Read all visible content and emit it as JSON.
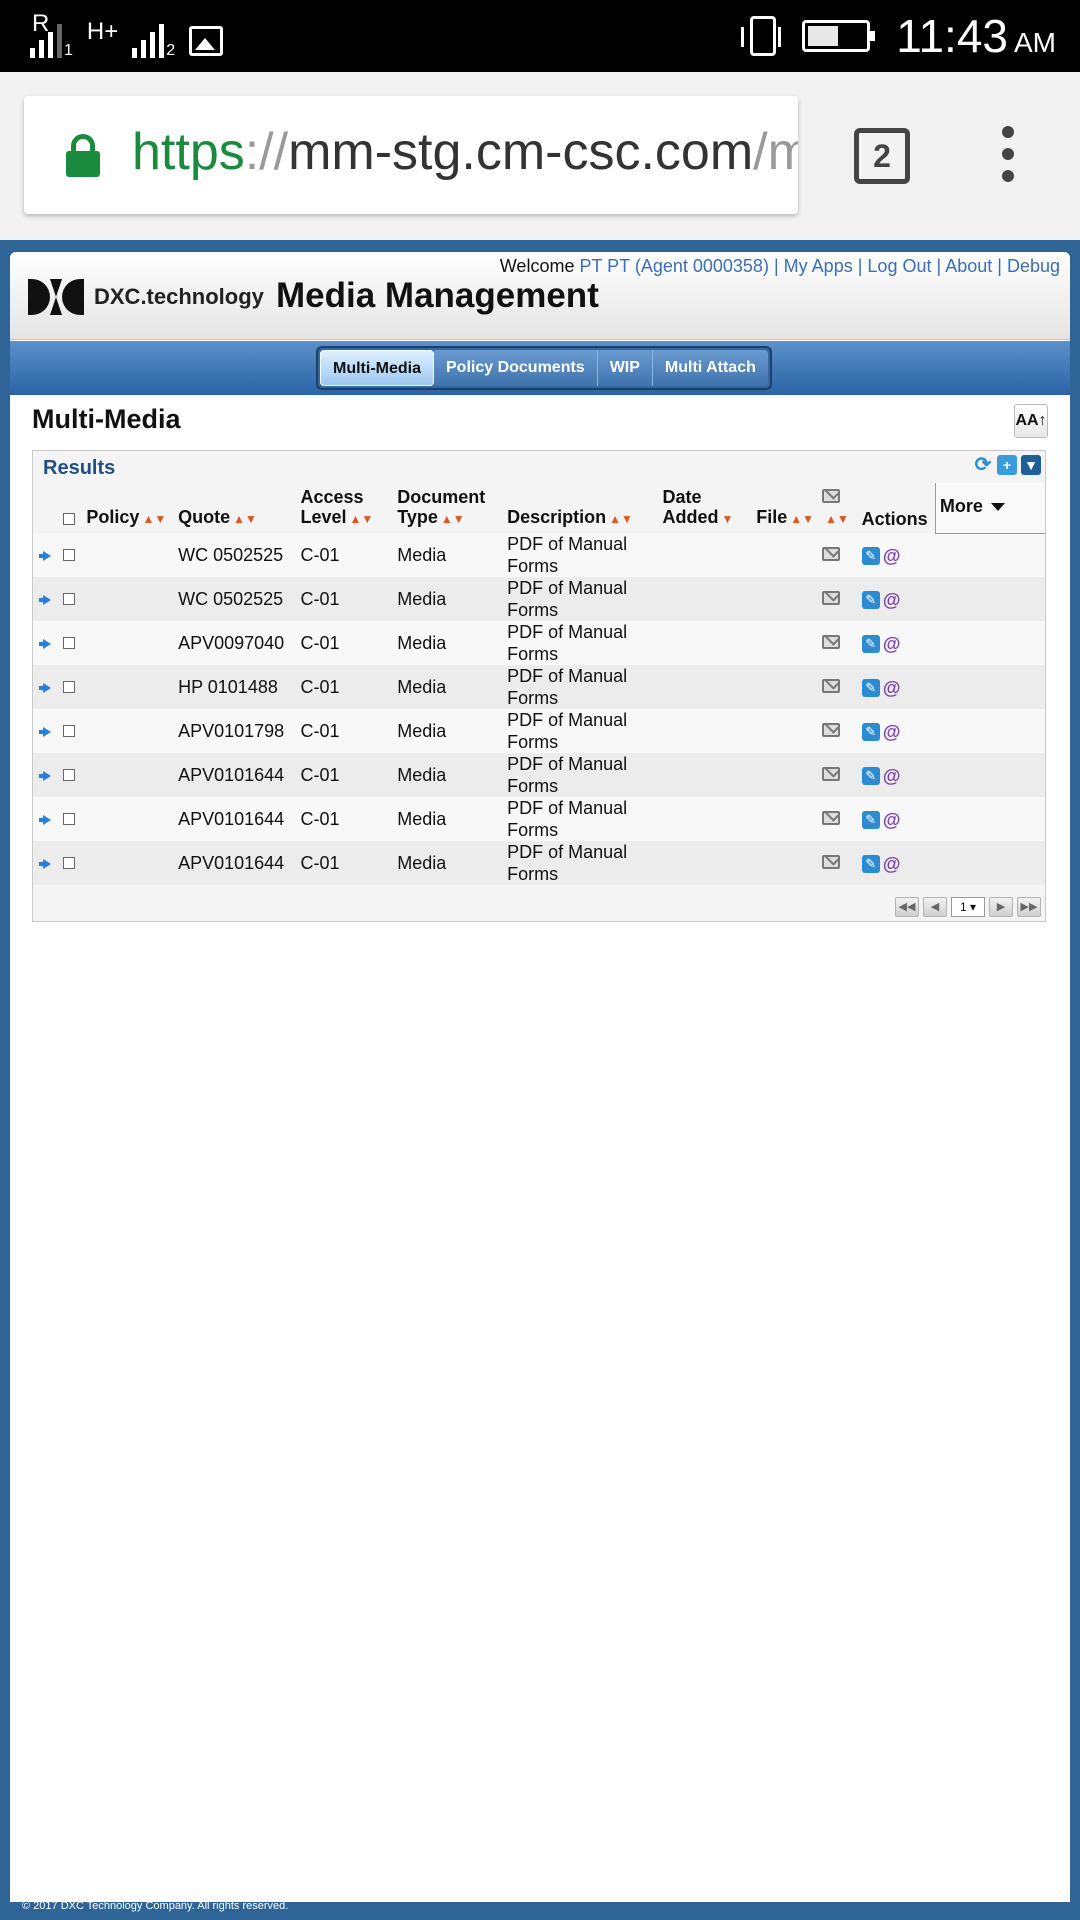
{
  "status_bar": {
    "signal1_label": "R",
    "signal1_sub": "1",
    "network": "H+",
    "signal2_sub": "2",
    "time": "11:43",
    "ampm": "AM",
    "icons": [
      "signal-icon",
      "data-icon",
      "signal-icon",
      "image-icon",
      "vibrate-icon",
      "battery-icon"
    ]
  },
  "browser": {
    "url_scheme": "https",
    "url_sep": "://",
    "url_host": "mm-stg.cm-csc.com",
    "url_rest": "/m",
    "tab_count": "2"
  },
  "header": {
    "logo_text": "DXC.technology",
    "title": "Media Management",
    "welcome_prefix": "Welcome",
    "user": "PT PT (Agent 0000358)",
    "links": [
      "My Apps",
      "Log Out",
      "About",
      "Debug"
    ]
  },
  "nav": {
    "tabs": [
      "Multi-Media",
      "Policy Documents",
      "WIP",
      "Multi Attach"
    ],
    "active": "Multi-Media"
  },
  "page": {
    "section_title": "Multi-Media",
    "text_size_label": "AA↑",
    "results_title": "Results"
  },
  "table": {
    "headers": {
      "policy": "Policy",
      "quote": "Quote",
      "access_level": "Access Level",
      "access_level_l1": "Access",
      "access_level_l2": "Level",
      "document_type_l1": "Document",
      "document_type_l2": "Type",
      "description": "Description",
      "date_added_l1": "Date",
      "date_added_l2": "Added",
      "file": "File",
      "actions": "Actions",
      "more": "More"
    },
    "rows": [
      {
        "quote": "WC 0502525",
        "access": "C-01",
        "type": "Media",
        "desc1": "PDF of Manual",
        "desc2": "Forms"
      },
      {
        "quote": "WC 0502525",
        "access": "C-01",
        "type": "Media",
        "desc1": "PDF of Manual",
        "desc2": "Forms"
      },
      {
        "quote": "APV0097040",
        "access": "C-01",
        "type": "Media",
        "desc1": "PDF of Manual",
        "desc2": "Forms"
      },
      {
        "quote": "HP 0101488",
        "access": "C-01",
        "type": "Media",
        "desc1": "PDF of Manual",
        "desc2": "Forms"
      },
      {
        "quote": "APV0101798",
        "access": "C-01",
        "type": "Media",
        "desc1": "PDF of Manual",
        "desc2": "Forms"
      },
      {
        "quote": "APV0101644",
        "access": "C-01",
        "type": "Media",
        "desc1": "PDF of Manual",
        "desc2": "Forms"
      },
      {
        "quote": "APV0101644",
        "access": "C-01",
        "type": "Media",
        "desc1": "PDF of Manual",
        "desc2": "Forms"
      },
      {
        "quote": "APV0101644",
        "access": "C-01",
        "type": "Media",
        "desc1": "PDF of Manual",
        "desc2": "Forms"
      }
    ]
  },
  "pager": {
    "page": "1 ▾"
  },
  "footer": {
    "copyright": "© 2017 DXC Technology Company. All rights reserved."
  },
  "colors": {
    "accent_blue": "#2a64a6",
    "link": "#3a6fb8",
    "sort_arrow": "#e0561e",
    "secure_green": "#1a8a3c"
  }
}
